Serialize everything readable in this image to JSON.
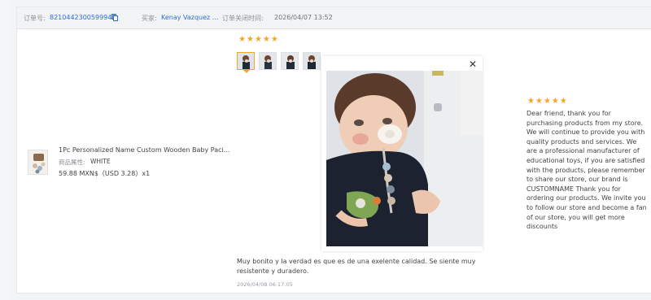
{
  "header": {
    "order_label": "订单号:",
    "order_number": "8210442300599948",
    "buyer_label": "买家:",
    "buyer_name": "Kenay Vazquez ...",
    "close_time_label": "订单关闭时间:",
    "close_time": "2026/04/07 13:52"
  },
  "product": {
    "title": "1Pc Personalized Name Custom Wooden Baby Paci...",
    "attr_label": "商品属性:",
    "attr_value": "WHITE",
    "price": "59.88 MXN$（USD  3.28）x1"
  },
  "review": {
    "rating": 5,
    "text": "Muy bonito y la verdad es que es de una exelente calidad. Se siente muy resistente y duradero.",
    "date": "2026/04/08 06:17:05",
    "photo_count": 4,
    "selected_photo": 1
  },
  "seller_reply": {
    "rating": 5,
    "text": "Dear friend, thank you for purchasing products from my store. We will continue to provide you with quality products and services. We are a professional manufacturer of educational toys, if you are satisfied with the products, please remember to share our store, our brand is CUSTOMNAME Thank you for ordering our products. We invite you to follow our store and become a fan of our store, you will get more discounts"
  },
  "icons": {
    "close": "close-icon",
    "copy": "copy-icon",
    "star": "star-icon"
  },
  "colors": {
    "link": "#2a6fd6",
    "star": "#f3a623",
    "header_bg": "#f2f3f5"
  }
}
